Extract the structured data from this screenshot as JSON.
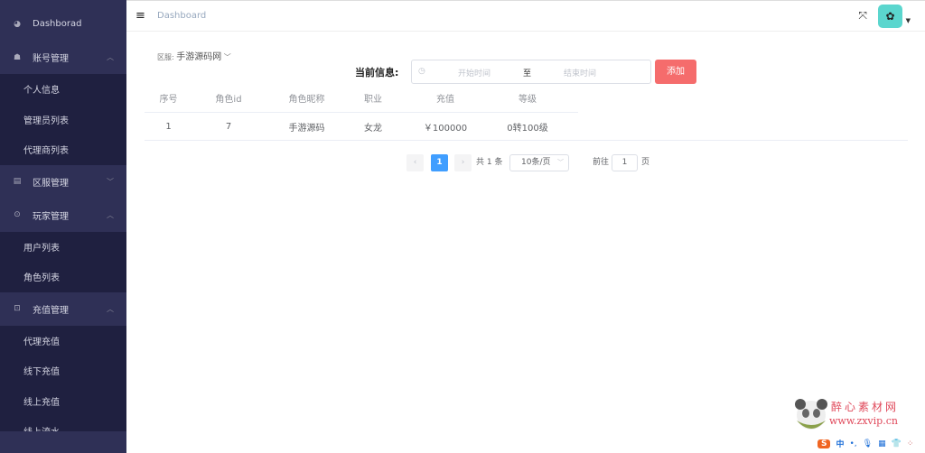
{
  "sidebar": {
    "dashboard": "Dashborad",
    "groups": [
      {
        "label": "账号管理",
        "icon": "users-icon",
        "expanded": true,
        "items": [
          "个人信息",
          "管理员列表",
          "代理商列表"
        ]
      },
      {
        "label": "区服管理",
        "icon": "server-list-icon",
        "expanded": false,
        "items": []
      },
      {
        "label": "玩家管理",
        "icon": "gamepad-icon",
        "expanded": true,
        "items": [
          "用户列表",
          "角色列表"
        ]
      },
      {
        "label": "充值管理",
        "icon": "money-icon",
        "expanded": true,
        "items": [
          "代理充值",
          "线下充值",
          "线上充值",
          "线上流水"
        ]
      }
    ]
  },
  "header": {
    "breadcrumb": "Dashboard",
    "fullscreen_icon": "fullscreen-icon",
    "avatar_icon": "avatar-icon"
  },
  "filter": {
    "region_label": "区服:",
    "region_value": "手游源码网",
    "current_label": "当前信息:",
    "start_placeholder": "开始时间",
    "separator": "至",
    "end_placeholder": "结束时间",
    "add_button": "添加",
    "add_color": "#f56c6c"
  },
  "table": {
    "headers": [
      "序号",
      "角色id",
      "角色昵称",
      "职业",
      "充值",
      "等级"
    ],
    "rows": [
      [
        "1",
        "7",
        "手游源码",
        "女龙",
        "￥100000",
        "0转100级"
      ]
    ]
  },
  "pagination": {
    "current_page": "1",
    "total": "共 1 条",
    "page_size": "10条/页",
    "goto_label": "前往",
    "goto_value": "1",
    "page_suffix": "页"
  },
  "watermark": {
    "name": "醉心素材网",
    "url": "www.zxvip.cn"
  },
  "ime": {
    "mode": "中"
  }
}
